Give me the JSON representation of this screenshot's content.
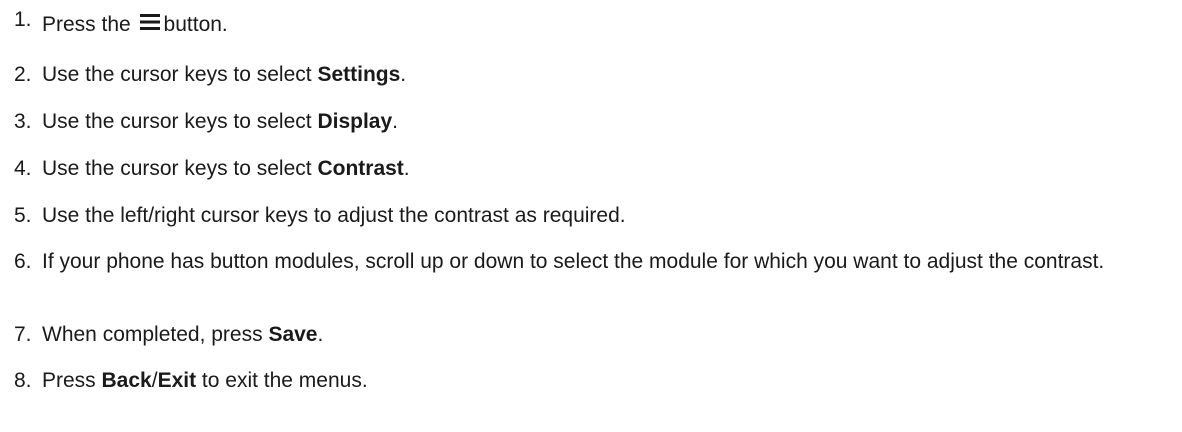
{
  "steps": [
    {
      "number": "1.",
      "parts": [
        "Press the ",
        "button."
      ],
      "icon": "menu-icon"
    },
    {
      "number": "2.",
      "parts": [
        "Use the cursor keys to select ",
        "Settings",
        "."
      ]
    },
    {
      "number": "3.",
      "parts": [
        "Use the cursor keys to select ",
        "Display",
        "."
      ]
    },
    {
      "number": "4.",
      "parts": [
        "Use the cursor keys to select ",
        "Contrast",
        "."
      ]
    },
    {
      "number": "5.",
      "parts": [
        "Use the left/right cursor keys to adjust the contrast as required."
      ]
    },
    {
      "number": "6.",
      "parts": [
        "If your phone has button modules, scroll up or down to select the module for which you want to adjust the contrast."
      ]
    },
    {
      "number": "7.",
      "parts": [
        "When completed, press ",
        "Save",
        "."
      ]
    },
    {
      "number": "8.",
      "parts": [
        "Press ",
        "Back",
        "/",
        "Exit",
        " to exit the menus."
      ]
    }
  ]
}
